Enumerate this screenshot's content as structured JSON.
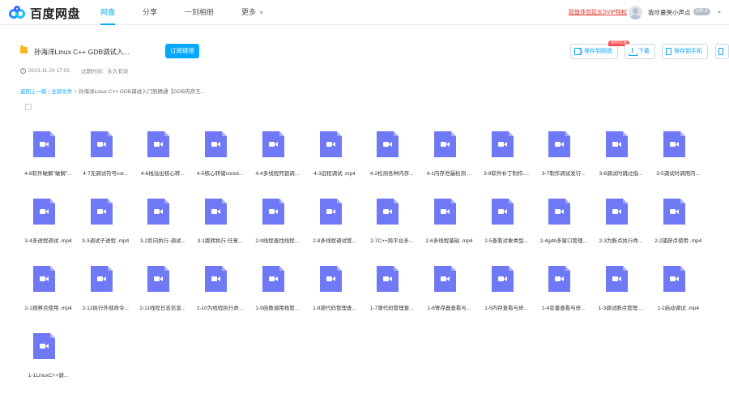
{
  "topbar": {
    "logo_text": "百度网盘",
    "nav": [
      "网盘",
      "分享",
      "一刻相册",
      "更多"
    ],
    "svip_promo": "超值体验延长SVIP特权",
    "username": "我尽量哭小声点",
    "vip_level": "VIP 3"
  },
  "share": {
    "title": "孙海洋Linux C++ GDB调试入...",
    "subscribe_label": "订阅链接",
    "date": "2023-11-24 17:03",
    "expire": "过期时间：永久有效",
    "save_label": "保存到网盘",
    "hot_tag": "限时优惠",
    "download_label": "下载",
    "save_phone_label": "保存到手机"
  },
  "breadcrumb": {
    "back": "返回上一级",
    "all_files": "全部文件",
    "current": "孙海洋Linux C++ GDB调试入门到精通【GDB内存王..."
  },
  "files": [
    "4-8软件破解\"破解\"...",
    "4-7无调试符号cor...",
    "4-6栈溢出核心转...",
    "4-5核心转储cored...",
    "4-4多线程死锁调...",
    "4-3远程调试 .mp4",
    "4-2检测各种内存...",
    "4-1内存泄漏检测 ...",
    "3-8软件补丁制作-...",
    "3-7制作调试发行...",
    "3-6调试时跳过指...",
    "3-5调试时调用内...",
    "3-4多进程调试 .mp4",
    "3-3调试子进程 .mp4",
    "3-2反向执行-调试...",
    "3-1跳转执行-任意...",
    "2-9线程查找线程...",
    "2-8多线程调试管...",
    "2-7C++跨平台多...",
    "2-6多线程基础 .mp4",
    "2-5查看对象类型...",
    "2-4gdb多窗口管理...",
    "2-3为断点执行命...",
    "2-2捕获点使用 .mp4",
    "2-1观察点使用 .mp4",
    "2-12执行外部命令...",
    "2-11线程日志信息...",
    "2-10为线程执行命...",
    "1-9函数调用栈管...",
    "1-8源代码管理查...",
    "1-7源代码管理查...",
    "1-6寄存器查看与...",
    "1-5内存查看与修...",
    "1-4变量查看与修...",
    "1-3调试断点管理 ...",
    "1-2启动调试 .mp4",
    "1-1LinuxC++调..."
  ]
}
